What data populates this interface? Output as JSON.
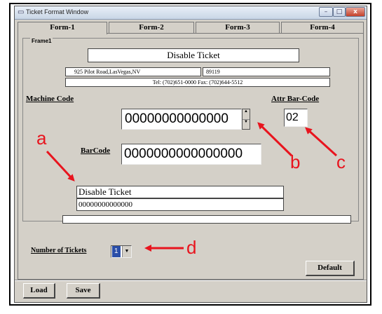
{
  "window": {
    "title": "Ticket Format Window"
  },
  "window_buttons": {
    "minimize": "–",
    "maximize": "□",
    "close": "x"
  },
  "tabs": [
    {
      "label": "Form-1",
      "active": true
    },
    {
      "label": "Form-2",
      "active": false
    },
    {
      "label": "Form-3",
      "active": false
    },
    {
      "label": "Form-4",
      "active": false
    }
  ],
  "frame": {
    "label": "Frame1"
  },
  "fields": {
    "ticket_title": "Disable Ticket",
    "address": "925 Pilot Road,LasVegas,NV",
    "zip": "89119",
    "phone": "Tel: (702)651-0000  Fax: (702)644-5512",
    "machine_code_label": "Machine Code",
    "machine_code_value": "00000000000000",
    "attr_barcode_label": "Attr Bar-Code",
    "attr_barcode_value": "02",
    "barcode_label": "BarCode",
    "barcode_value": "0000000000000000",
    "preview_title": "Disable Ticket",
    "preview_code": "00000000000000",
    "footer_text": ""
  },
  "tickets": {
    "label": "Number of Tickets",
    "value": "1"
  },
  "buttons": {
    "default": "Default",
    "load": "Load",
    "save": "Save"
  },
  "callouts": {
    "a": "a",
    "b": "b",
    "c": "c",
    "d": "d"
  },
  "colors": {
    "callout": "#e8141e",
    "window_bg": "#d4d0c8"
  }
}
